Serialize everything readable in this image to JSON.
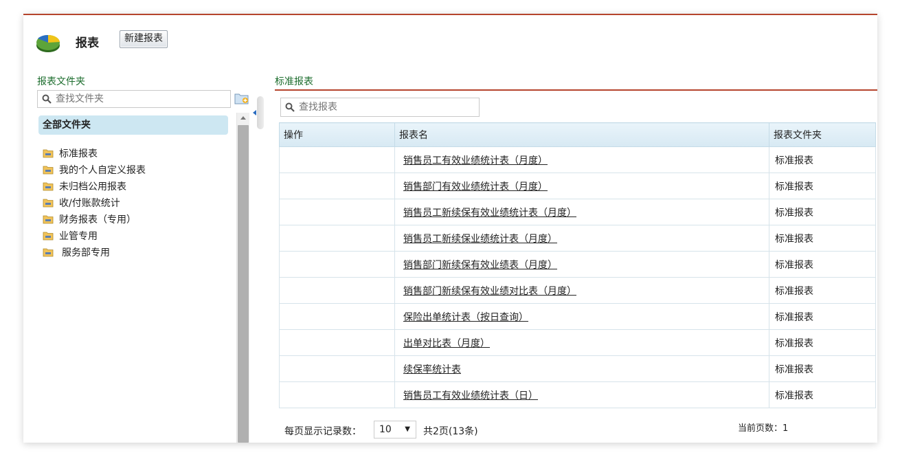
{
  "header": {
    "title": "报表",
    "new_report_button": "新建报表"
  },
  "sidebar": {
    "title": "报表文件夹",
    "search_placeholder": "查找文件夹",
    "all_folders_label": "全部文件夹",
    "folders": [
      {
        "label": "标准报表"
      },
      {
        "label": "我的个人自定义报表"
      },
      {
        "label": "未归档公用报表"
      },
      {
        "label": "收/付账款统计"
      },
      {
        "label": "财务报表（专用）"
      },
      {
        "label": "业管专用"
      },
      {
        "label": "服务部专用"
      }
    ]
  },
  "main": {
    "title": "标准报表",
    "search_placeholder": "查找报表",
    "columns": {
      "action": "操作",
      "name": "报表名",
      "folder": "报表文件夹"
    },
    "rows": [
      {
        "name": "销售员工有效业绩统计表（月度）",
        "folder": "标准报表"
      },
      {
        "name": "销售部门有效业绩统计表（月度）",
        "folder": "标准报表"
      },
      {
        "name": "销售员工新续保有效业绩统计表（月度）",
        "folder": "标准报表"
      },
      {
        "name": "销售员工新续保业绩统计表（月度）",
        "folder": "标准报表"
      },
      {
        "name": "销售部门新续保有效业绩表（月度）",
        "folder": "标准报表"
      },
      {
        "name": "销售部门新续保有效业绩对比表（月度）",
        "folder": "标准报表"
      },
      {
        "name": "保险出单统计表（按日查询）",
        "folder": "标准报表"
      },
      {
        "name": "出单对比表（月度）",
        "folder": "标准报表"
      },
      {
        "name": "续保率统计表",
        "folder": "标准报表"
      },
      {
        "name": "销售员工有效业绩统计表（日）",
        "folder": "标准报表"
      }
    ],
    "footer": {
      "page_size_label": "每页显示记录数：",
      "page_size_value": "10",
      "total_text": "共2页(13条)",
      "current_page_label": "当前页数：",
      "current_page_value": "1"
    }
  },
  "colors": {
    "accent_line": "#b5442c",
    "folder_title": "#1b6c2c",
    "selected_folder_bg": "#cde7f2",
    "table_header_bg": "#d7e9f3"
  },
  "icons": {
    "logo": "reports-pie-logo-icon",
    "search": "search-icon",
    "new_folder": "new-folder-icon",
    "folder": "folder-icon",
    "collapse": "collapse-left-icon",
    "dropdown": "chevron-down-icon"
  }
}
